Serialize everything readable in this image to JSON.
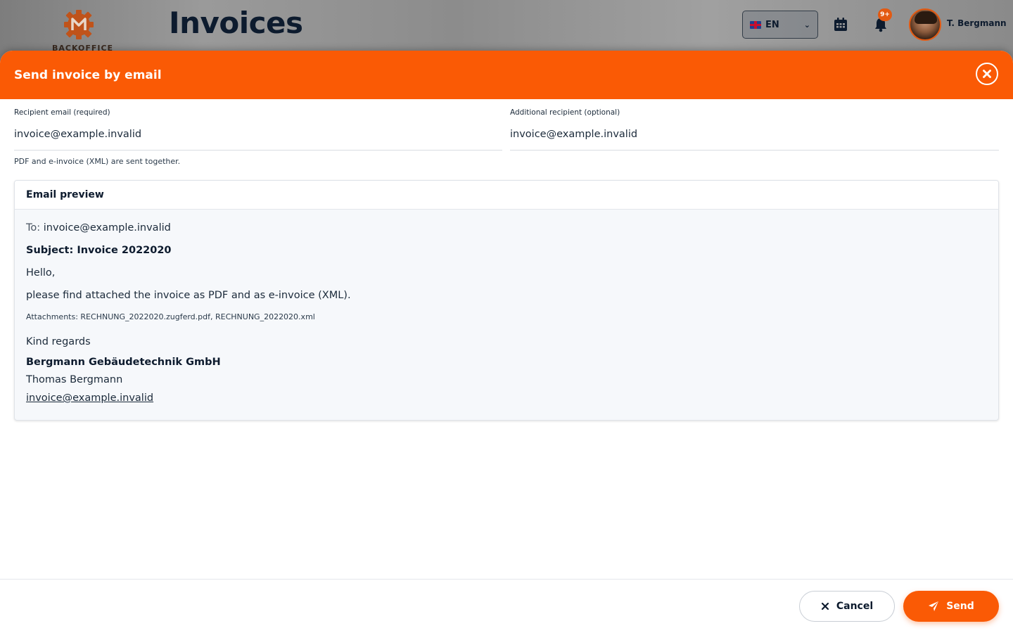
{
  "background": {
    "logo_text": "BACKOFFICE",
    "page_title": "Invoices",
    "language": "EN",
    "notification_badge": "9+",
    "user_name": "T. Bergmann"
  },
  "modal": {
    "title": "Send invoice by email",
    "recipient": {
      "label": "Recipient email (required)",
      "value": "invoice@example.invalid"
    },
    "additional": {
      "label": "Additional recipient (optional)",
      "value": "invoice@example.invalid"
    },
    "hint": "PDF and e-invoice (XML) are sent together.",
    "preview": {
      "heading": "Email preview",
      "to_label": "To:",
      "to_value": "invoice@example.invalid",
      "subject": "Subject: Invoice 2022020",
      "greeting": "Hello,",
      "body": "please find attached the invoice as PDF and as e-invoice (XML).",
      "attachments": "Attachments: RECHNUNG_2022020.zugferd.pdf, RECHNUNG_2022020.xml",
      "regards": "Kind regards",
      "company": "Bergmann Gebäudetechnik GmbH",
      "sender_name": "Thomas Bergmann",
      "sender_email": "invoice@example.invalid"
    },
    "buttons": {
      "cancel": "Cancel",
      "send": "Send"
    }
  },
  "colors": {
    "accent": "#fa5a05",
    "navy": "#0d1b2e"
  }
}
